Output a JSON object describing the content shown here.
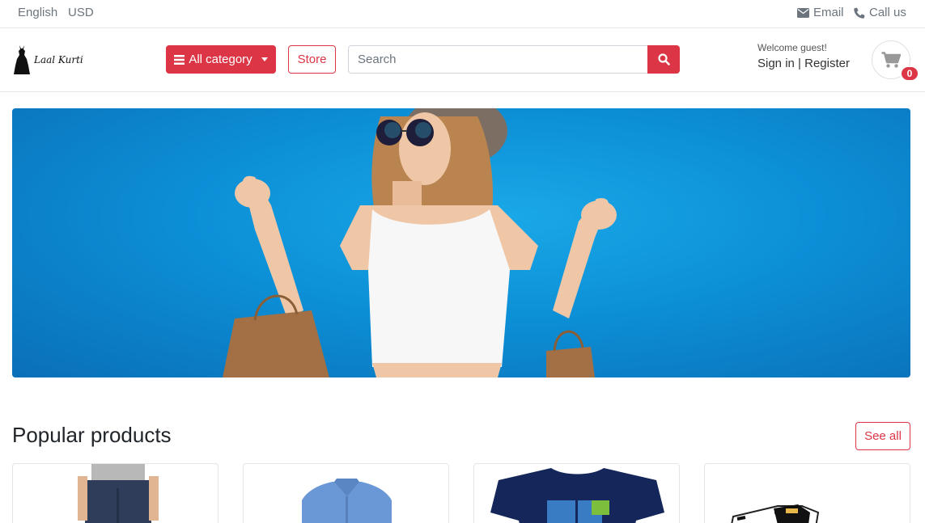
{
  "topbar": {
    "language": "English",
    "currency": "USD",
    "email_label": "Email",
    "call_label": "Call us"
  },
  "header": {
    "logo_text": "Laal Kurti",
    "category_button": "All category",
    "store_button": "Store",
    "search_placeholder": "Search",
    "welcome": "Welcome guest!",
    "sign_in": "Sign in",
    "separator": " | ",
    "register": "Register",
    "cart_count": "0"
  },
  "section": {
    "title": "Popular products",
    "see_all": "See all"
  },
  "colors": {
    "accent": "#dc3545",
    "banner_blue": "#0c8fd6"
  },
  "icons": [
    "envelope-icon",
    "phone-icon",
    "bars-icon",
    "search-icon",
    "cart-icon"
  ]
}
